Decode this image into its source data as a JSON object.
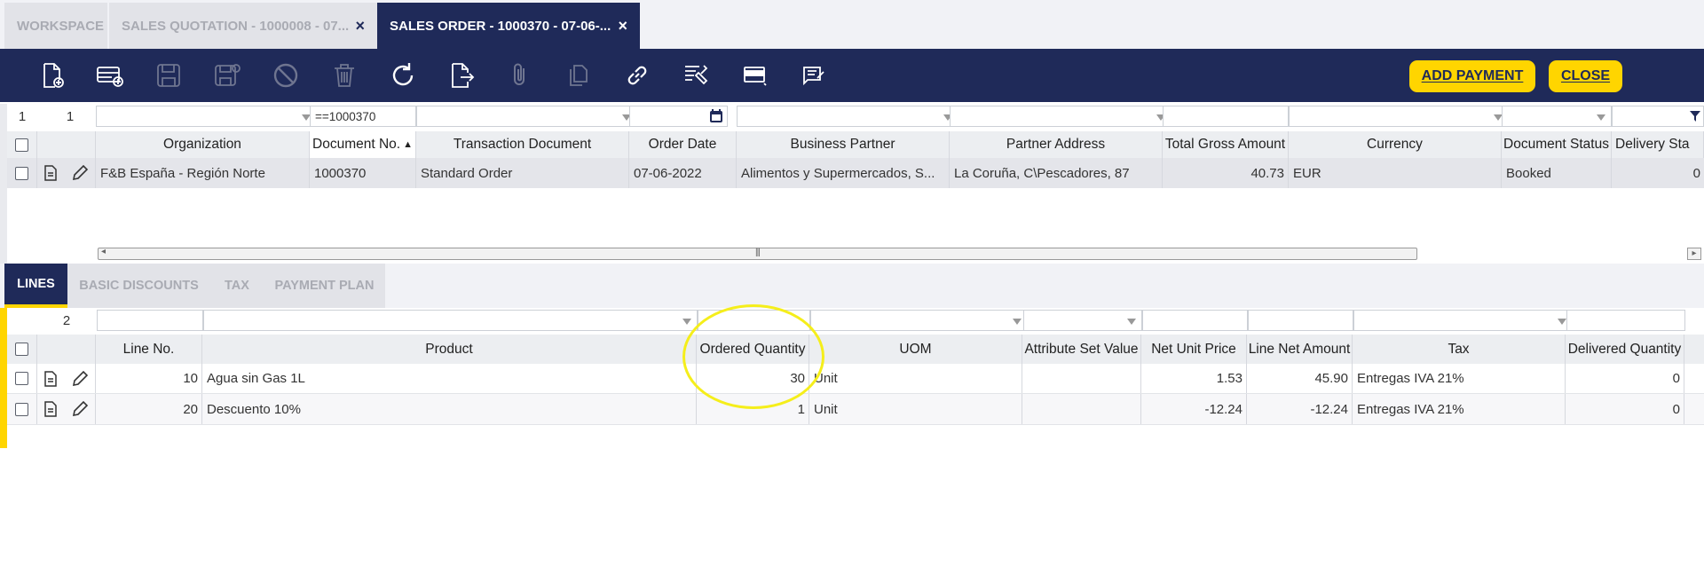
{
  "tabs": [
    {
      "label": "WORKSPACE",
      "closable": false
    },
    {
      "label": "SALES QUOTATION - 1000008 - 07...",
      "closable": true
    },
    {
      "label": "SALES ORDER - 1000370 - 07-06-...",
      "closable": true,
      "active": true
    }
  ],
  "toolbar": {
    "icons": [
      "new-document-icon",
      "new-row-icon",
      "save-icon",
      "save-close-icon",
      "cancel-icon",
      "delete-icon",
      "refresh-icon",
      "export-icon",
      "attach-icon",
      "copy-record-icon",
      "link-icon",
      "tools-icon",
      "form-view-icon",
      "notes-icon"
    ],
    "add_payment_label": "ADD PAYMENT",
    "close_label": "CLOSE"
  },
  "header_grid": {
    "selected_count": "1",
    "row_count": "1",
    "filter_document_no": "==1000370",
    "columns": [
      "Organization",
      "Document No.",
      "Transaction Document",
      "Order Date",
      "Business Partner",
      "Partner Address",
      "Total Gross Amount",
      "Currency",
      "Document Status",
      "Delivery Sta"
    ],
    "sort_indicator": "▲",
    "rows": [
      {
        "organization": "F&B España - Región Norte",
        "document_no": "1000370",
        "transaction_document": "Standard Order",
        "order_date": "07-06-2022",
        "business_partner": "Alimentos y Supermercados, S...",
        "partner_address": "La Coruña, C\\Pescadores, 87",
        "total_gross_amount": "40.73",
        "currency": "EUR",
        "document_status": "Booked",
        "delivery_status": "0"
      }
    ]
  },
  "subtabs": [
    "LINES",
    "BASIC DISCOUNTS",
    "TAX",
    "PAYMENT PLAN"
  ],
  "lines_grid": {
    "row_count": "2",
    "columns": [
      "Line No.",
      "Product",
      "Ordered Quantity",
      "UOM",
      "Attribute Set Value",
      "Net Unit Price",
      "Line Net Amount",
      "Tax",
      "Delivered Quantity"
    ],
    "rows": [
      {
        "line_no": "10",
        "product": "Agua sin Gas 1L",
        "ordered_quantity": "30",
        "uom": "Unit",
        "attribute_set_value": "",
        "net_unit_price": "1.53",
        "line_net_amount": "45.90",
        "tax": "Entregas IVA 21%",
        "delivered_quantity": "0"
      },
      {
        "line_no": "20",
        "product": "Descuento 10%",
        "ordered_quantity": "1",
        "uom": "Unit",
        "attribute_set_value": "",
        "net_unit_price": "-12.24",
        "line_net_amount": "-12.24",
        "tax": "Entregas IVA 21%",
        "delivered_quantity": "0"
      }
    ]
  },
  "colors": {
    "navy": "#1f2a59",
    "accent": "#ffd500",
    "highlight": "#f5ee1b"
  }
}
